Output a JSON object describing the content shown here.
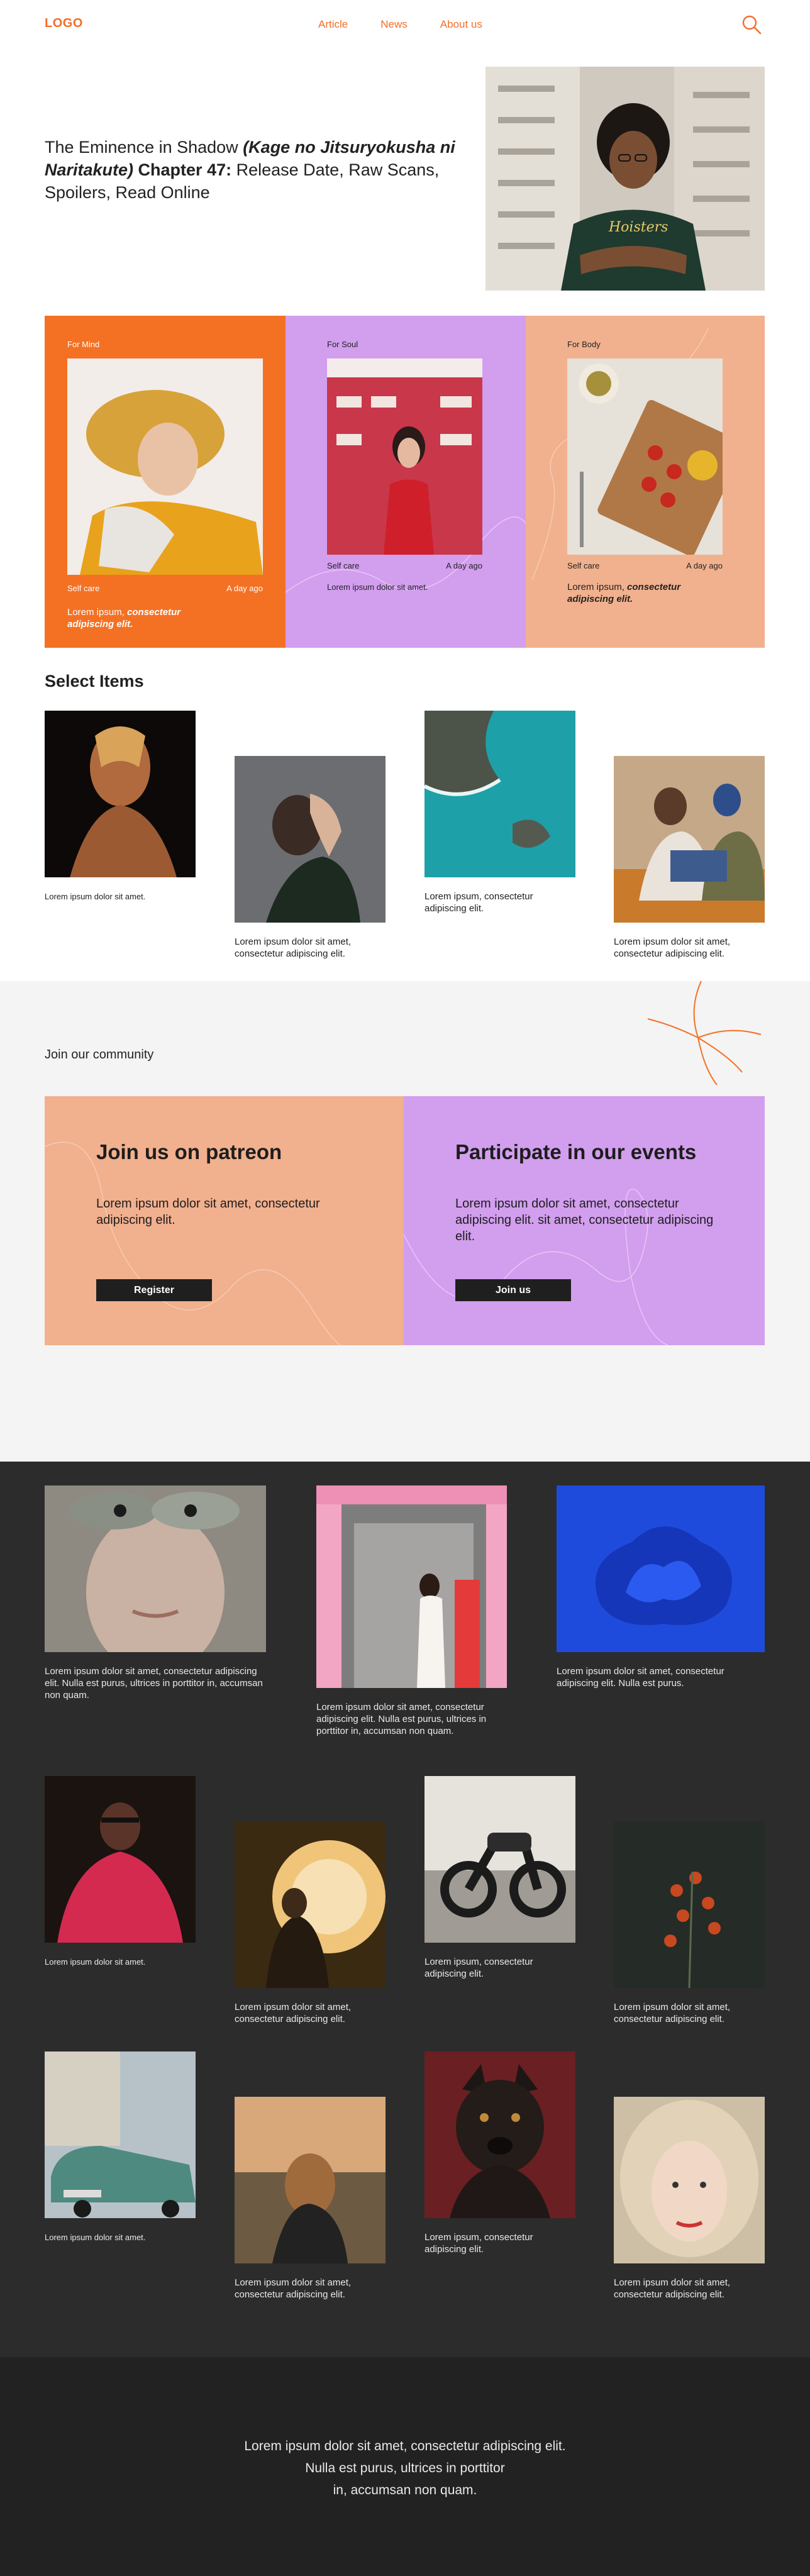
{
  "header": {
    "logo": "LOGO",
    "nav": [
      "Article",
      "News",
      "About us"
    ]
  },
  "hero": {
    "title_plain_1": "The Eminence in Shadow ",
    "title_italic": "(Kage no Jitsuryokusha ni Naritakute)",
    "title_bold": " Chapter 47:",
    "title_plain_2": " Release Date, Raw Scans, Spoilers, Read Online",
    "image_alt": "Young man with curly hair and glasses, arms crossed, in front of a building"
  },
  "panels": [
    {
      "tag": "For Mind",
      "category": "Self care",
      "time": "A day ago",
      "desc_plain": "Lorem ipsum, ",
      "desc_italic": "consectetur adipiscing elit."
    },
    {
      "tag": "For Soul",
      "category": "Self care",
      "time": "A day ago",
      "desc_plain": "Lorem ipsum dolor sit amet.",
      "desc_italic": ""
    },
    {
      "tag": "For Body",
      "category": "Self care",
      "time": "A day ago",
      "desc_plain": "Lorem ipsum, ",
      "desc_italic": "consectetur adipiscing elit."
    }
  ],
  "select_items": {
    "title": "Select Items",
    "items": [
      {
        "caption": "Lorem ipsum dolor sit amet."
      },
      {
        "caption": "Lorem ipsum dolor sit amet, consectetur adipiscing elit."
      },
      {
        "caption": "Lorem ipsum, consectetur adipiscing elit."
      },
      {
        "caption": "Lorem ipsum dolor sit amet, consectetur adipiscing elit."
      }
    ]
  },
  "community": {
    "label": "Join our community",
    "cards": [
      {
        "title": "Join us on patreon",
        "text": "Lorem ipsum dolor sit amet, consectetur adipiscing elit.",
        "button": "Register"
      },
      {
        "title": "Participate in our events",
        "text": "Lorem ipsum dolor sit amet, consectetur adipiscing elit. sit amet, consectetur adipiscing elit.",
        "button": "Join us"
      }
    ]
  },
  "gallery": {
    "featured": [
      {
        "caption": "Lorem ipsum dolor sit amet, consectetur adipiscing elit. Nulla est purus, ultrices in porttitor in, accumsan non quam."
      },
      {
        "caption": "Lorem ipsum dolor sit amet, consectetur adipiscing elit. Nulla est purus, ultrices in porttitor in, accumsan non quam."
      },
      {
        "caption": "Lorem ipsum dolor sit amet, consectetur adipiscing elit. Nulla est purus."
      }
    ],
    "row2": [
      {
        "caption": "Lorem ipsum dolor sit amet."
      },
      {
        "caption": "Lorem ipsum dolor sit amet, consectetur adipiscing elit."
      },
      {
        "caption": "Lorem ipsum, consectetur adipiscing elit."
      },
      {
        "caption": "Lorem ipsum dolor sit amet, consectetur adipiscing elit."
      }
    ],
    "row3": [
      {
        "caption": "Lorem ipsum dolor sit amet."
      },
      {
        "caption": "Lorem ipsum dolor sit amet, consectetur adipiscing elit."
      },
      {
        "caption": "Lorem ipsum, consectetur adipiscing elit."
      },
      {
        "caption": "Lorem ipsum dolor sit amet, consectetur adipiscing elit."
      }
    ]
  },
  "footer": {
    "line1": "Lorem ipsum dolor sit amet, consectetur adipiscing elit.",
    "line2": "Nulla est purus, ultrices in porttitor",
    "line3": "in, accumsan non quam."
  }
}
